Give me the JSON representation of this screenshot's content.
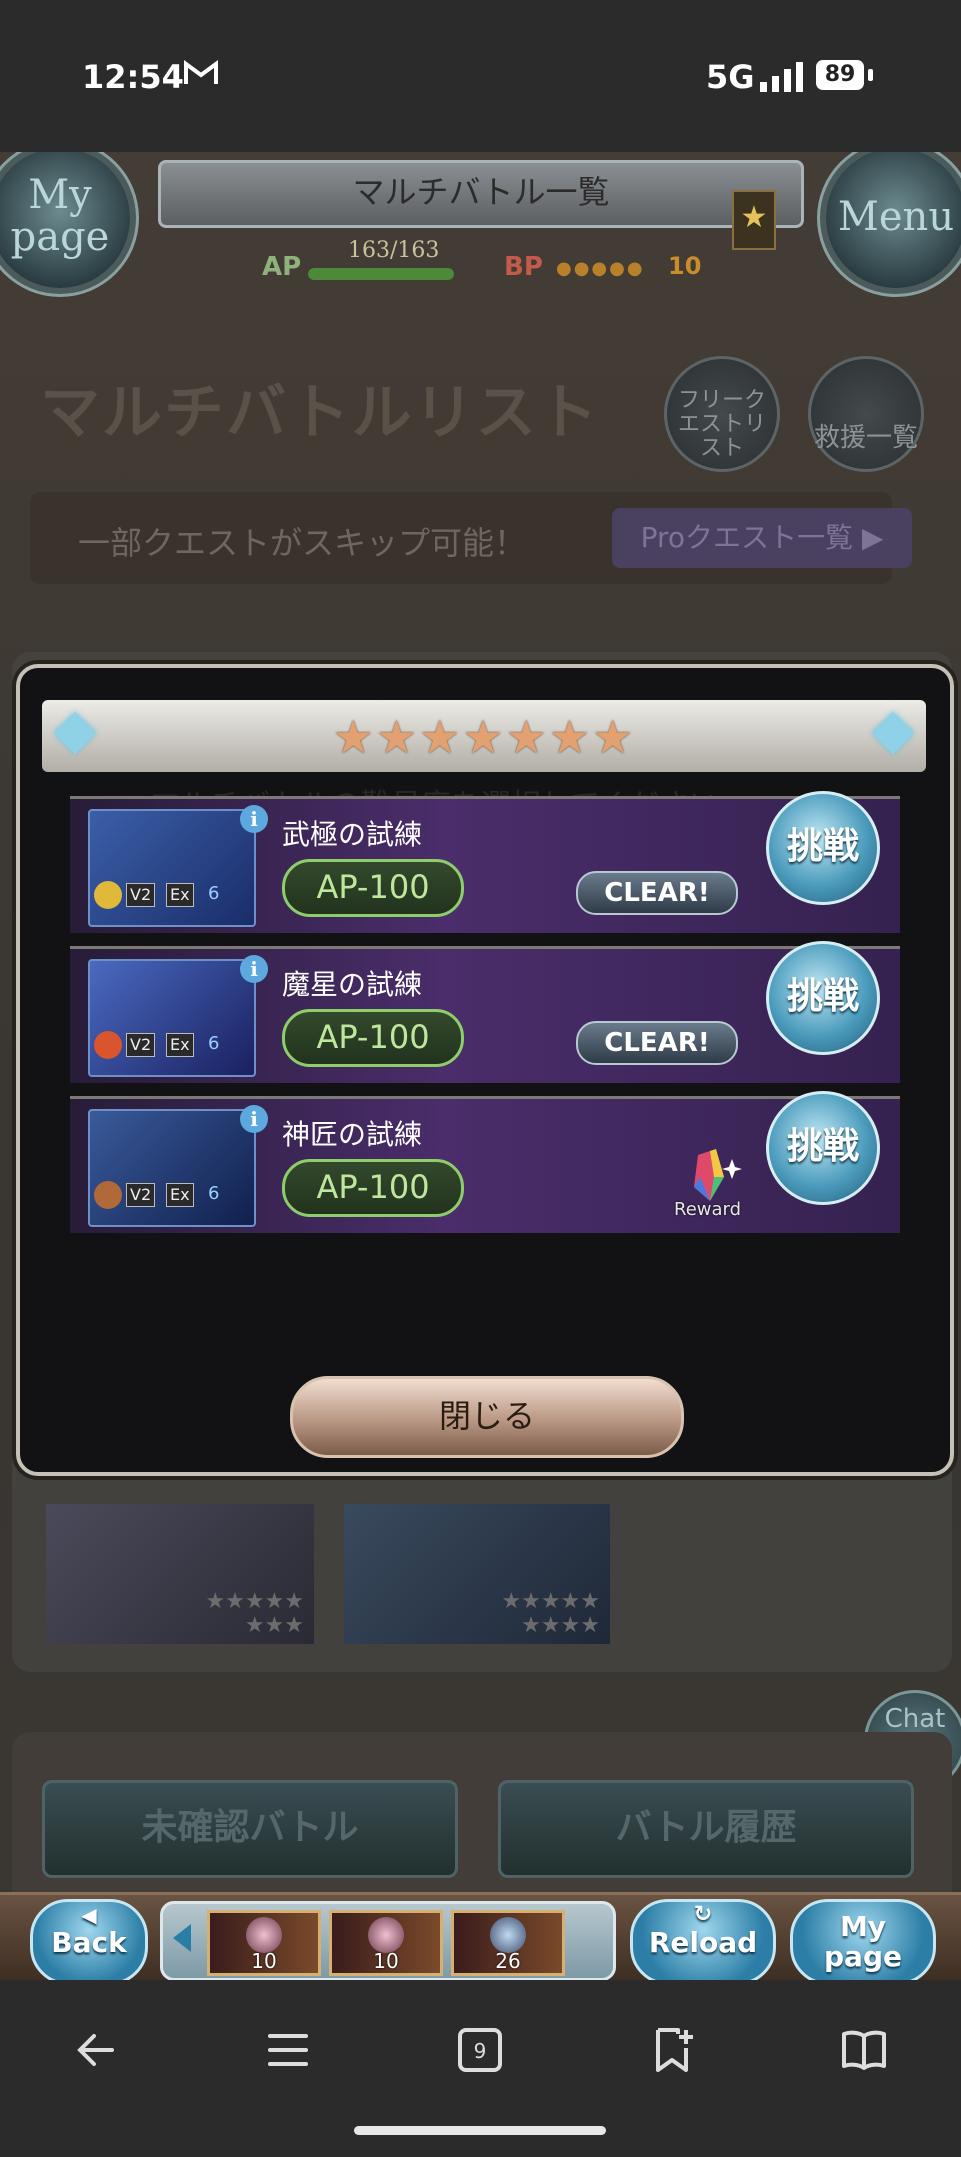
{
  "status_bar": {
    "time": "12:54",
    "network": "5G",
    "battery": "89"
  },
  "header": {
    "left_button": "My page",
    "title": "マルチバトル一覧",
    "right_button": "Menu",
    "rank_icon": "star-icon",
    "ap_label": "AP",
    "ap_value": "163/163",
    "ap_fraction": 1.0,
    "bp_label": "BP",
    "bp_dots": "●●●●●",
    "bp_value": "10"
  },
  "page": {
    "list_title": "マルチバトルリスト",
    "free_quest_label": "フリークエストリスト",
    "rescue_label": "救援一覧",
    "skip_text": "一部クエストがスキップ可能！",
    "pro_button": "Proクエスト一覧 ▶"
  },
  "dialog": {
    "stars": "★★★★★★★",
    "subtitle": "マルチバトルの難易度を選択してください",
    "quests": [
      {
        "name": "武極の試練",
        "ap": "AP-100",
        "status": "CLEAR!",
        "go": "挑戦",
        "v2": "V2",
        "ex": "Ex",
        "players": "6",
        "element_color": "#e0b83a"
      },
      {
        "name": "魔星の試練",
        "ap": "AP-100",
        "status": "CLEAR!",
        "go": "挑戦",
        "v2": "V2",
        "ex": "Ex",
        "players": "6",
        "element_color": "#d8552e"
      },
      {
        "name": "神匠の試練",
        "ap": "AP-100",
        "reward": "Reward",
        "go": "挑戦",
        "v2": "V2",
        "ex": "Ex",
        "players": "6",
        "element_color": "#b06a3a"
      }
    ],
    "close_button": "閉じる"
  },
  "tiles": [
    {
      "stars_line1": "★★★★★",
      "stars_line2": "★★★"
    },
    {
      "stars_line1": "★★★★★",
      "stars_line2": "★★★★"
    }
  ],
  "chat_button": "Chat",
  "bottom_buttons": {
    "unconfirmed": "未確認バトル",
    "history": "バトル履歴"
  },
  "navbar": {
    "back": "Back",
    "reload": "Reload",
    "mypage": "My page",
    "slots": [
      "10",
      "10",
      "26"
    ]
  },
  "colors": {
    "accent_green": "#8fcc6a",
    "go_blue": "#4c9cbd",
    "clear_bg": "#2f3b47"
  }
}
